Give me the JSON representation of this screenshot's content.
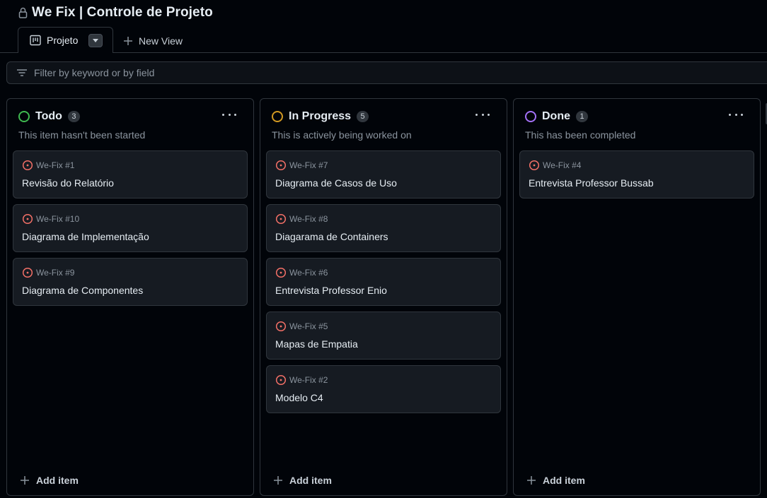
{
  "project": {
    "title": "We Fix | Controle de Projeto",
    "lock_icon": "lock-icon"
  },
  "tabs": {
    "active": {
      "label": "Projeto",
      "icon": "table-icon"
    },
    "new_view_label": "New View"
  },
  "filter": {
    "placeholder": "Filter by keyword or by field"
  },
  "colors": {
    "todo": "#3fb950",
    "in_progress": "#d29922",
    "done": "#a371f7",
    "issue_open": "#f47067"
  },
  "columns": [
    {
      "title": "Todo",
      "count": "3",
      "description": "This item hasn't been started",
      "status_color": "#3fb950",
      "add_label": "Add item",
      "cards": [
        {
          "ref": "We-Fix #1",
          "title": "Revisão do Relatório"
        },
        {
          "ref": "We-Fix #10",
          "title": "Diagrama de Implementação"
        },
        {
          "ref": "We-Fix #9",
          "title": "Diagrama de Componentes"
        }
      ]
    },
    {
      "title": "In Progress",
      "count": "5",
      "description": "This is actively being worked on",
      "status_color": "#d29922",
      "add_label": "Add item",
      "cards": [
        {
          "ref": "We-Fix #7",
          "title": "Diagrama de Casos de Uso"
        },
        {
          "ref": "We-Fix #8",
          "title": "Diagarama de Containers"
        },
        {
          "ref": "We-Fix #6",
          "title": "Entrevista Professor Enio"
        },
        {
          "ref": "We-Fix #5",
          "title": "Mapas de Empatia"
        },
        {
          "ref": "We-Fix #2",
          "title": "Modelo C4"
        }
      ]
    },
    {
      "title": "Done",
      "count": "1",
      "description": "This has been completed",
      "status_color": "#a371f7",
      "add_label": "Add item",
      "cards": [
        {
          "ref": "We-Fix #4",
          "title": "Entrevista Professor Bussab"
        }
      ]
    }
  ]
}
